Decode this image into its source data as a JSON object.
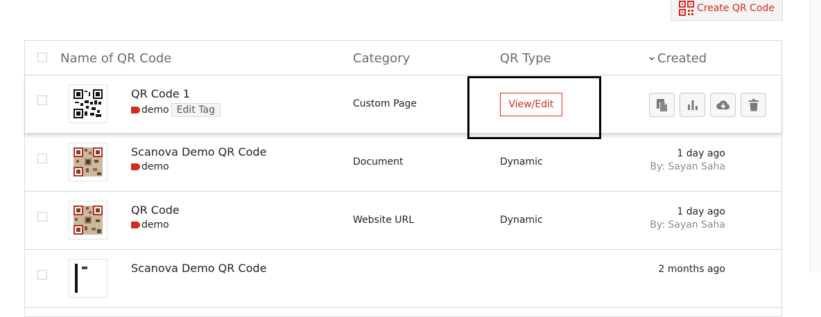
{
  "toolbar": {
    "create_label": "Create QR Code",
    "create_icon": "qr-code-icon"
  },
  "table": {
    "headers": {
      "name": "Name of QR Code",
      "category": "Category",
      "qr_type": "QR Type",
      "created": "Created",
      "sort_icon": "chevron-down-icon"
    },
    "rows": [
      {
        "name": "QR Code 1",
        "tag": "demo",
        "edit_tag": "Edit Tag",
        "category": "Custom Page",
        "qr_type_button": "View/Edit",
        "actions": [
          "copy-icon",
          "analytics-icon",
          "download-icon",
          "delete-icon"
        ]
      },
      {
        "name": "Scanova Demo QR Code",
        "tag": "demo",
        "category": "Document",
        "qr_type": "Dynamic",
        "created": "1 day ago",
        "created_by": "By: Sayan Saha"
      },
      {
        "name": "QR Code",
        "tag": "demo",
        "category": "Website URL",
        "qr_type": "Dynamic",
        "created": "1 day ago",
        "created_by": "By: Sayan Saha"
      },
      {
        "name": "Scanova Demo QR Code",
        "created": "2 months ago"
      }
    ]
  },
  "colors": {
    "accent": "#d22d1c",
    "border": "#d6d6d6",
    "muted": "#8a8a8a"
  }
}
